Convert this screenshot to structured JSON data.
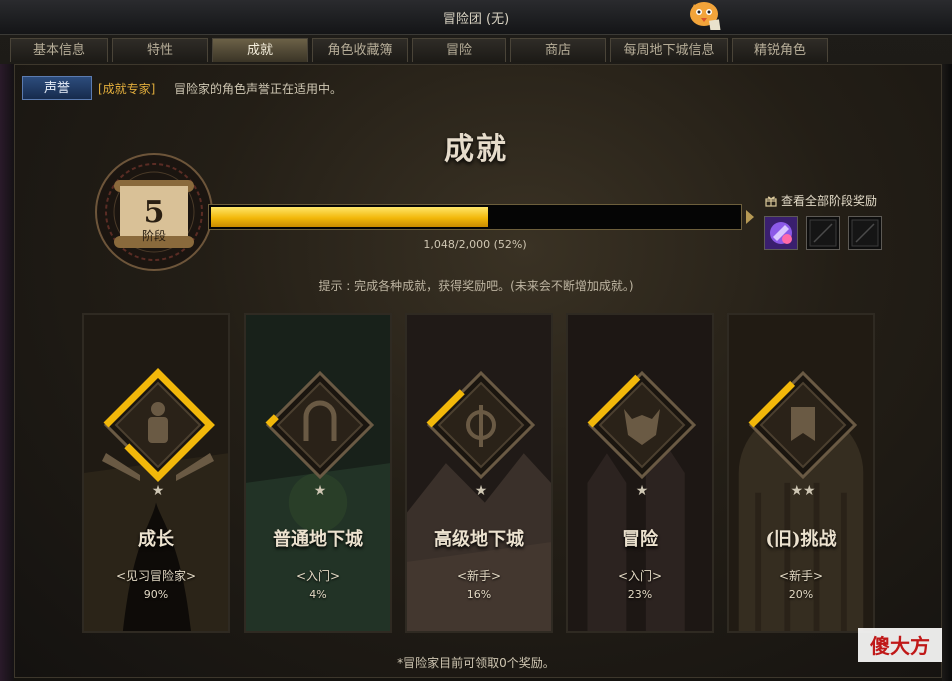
{
  "window": {
    "title": "冒险团 (无)"
  },
  "tabs": [
    {
      "label": "基本信息",
      "active": false
    },
    {
      "label": "特性",
      "active": false
    },
    {
      "label": "成就",
      "active": true
    },
    {
      "label": "角色收藏簿",
      "active": false
    },
    {
      "label": "冒险",
      "active": false
    },
    {
      "label": "商店",
      "active": false
    },
    {
      "label": "每周地下城信息",
      "active": false
    },
    {
      "label": "精锐角色",
      "active": false
    }
  ],
  "notice": {
    "button": "声誉",
    "tag": "[成就专家]",
    "text": "冒险家的角色声誉正在适用中。"
  },
  "heading": "成就",
  "stage": {
    "number": "5",
    "label": "阶段"
  },
  "progress": {
    "current": 1048,
    "max": 2000,
    "fraction": 0.524,
    "text": "1,048/2,000 (52%)"
  },
  "rewards": {
    "link": "查看全部阶段奖励",
    "slots": [
      {
        "icon": "potion-reward-icon",
        "filled": true
      },
      {
        "icon": "empty-slot-icon",
        "filled": false
      },
      {
        "icon": "empty-slot-icon",
        "filled": false
      }
    ]
  },
  "tip": "提示 : 完成各种成就，获得奖励吧。(未来会不断增加成就。)",
  "categories": [
    {
      "name": "成长",
      "rank": "<见习冒险家>",
      "percent": "90%",
      "progress": 0.9,
      "stars": 1,
      "icon": "body-silhouette-icon",
      "accent": "#5a4a2c"
    },
    {
      "name": "普通地下城",
      "rank": "<入门>",
      "percent": "4%",
      "progress": 0.04,
      "stars": 1,
      "icon": "gate-icon",
      "accent": "#2f4a2a"
    },
    {
      "name": "高级地下城",
      "rank": "<新手>",
      "percent": "16%",
      "progress": 0.16,
      "stars": 1,
      "icon": "sword-shield-icon",
      "accent": "#4a3c34"
    },
    {
      "name": "冒险",
      "rank": "<入门>",
      "percent": "23%",
      "progress": 0.23,
      "stars": 1,
      "icon": "demon-mask-icon",
      "accent": "#3a2a26"
    },
    {
      "name": "(旧)挑战",
      "rank": "<新手>",
      "percent": "20%",
      "progress": 0.2,
      "stars": 2,
      "icon": "banner-icon",
      "accent": "#3f3526"
    }
  ],
  "footer": "*冒险家目前可领取0个奖励。",
  "watermark": "傻大方",
  "colors": {
    "accent_gold": "#f2b80a",
    "emblem_dim": "#6a5a44",
    "button_blue": "#2d4c7c"
  }
}
